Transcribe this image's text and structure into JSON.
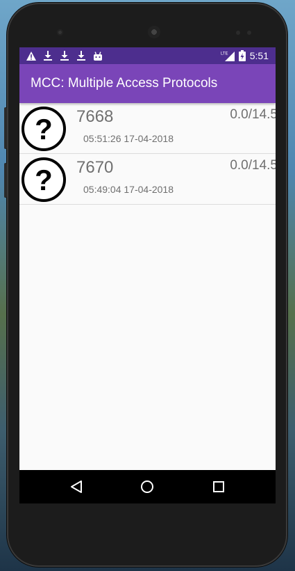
{
  "status_bar": {
    "time": "5:51",
    "network": "LTE",
    "notification_icons": [
      "warning-icon",
      "download-icon",
      "download-icon",
      "download-icon",
      "android-debug-icon"
    ]
  },
  "app_bar": {
    "title": "MCC: Multiple Access Protocols"
  },
  "list": {
    "items": [
      {
        "icon": "question-mark-icon",
        "id": "7668",
        "ratio": "0.0/14.5",
        "timestamp": "05:51:26 17-04-2018"
      },
      {
        "icon": "question-mark-icon",
        "id": "7670",
        "ratio": "0.0/14.5",
        "timestamp": "05:49:04 17-04-2018"
      }
    ]
  },
  "nav_bar": {
    "buttons": [
      "back-icon",
      "home-icon",
      "recents-icon"
    ]
  },
  "colors": {
    "status_bar": "#4d2e8e",
    "app_bar": "#7a45b8",
    "list_text": "#707070",
    "nav_bar": "#000000"
  }
}
